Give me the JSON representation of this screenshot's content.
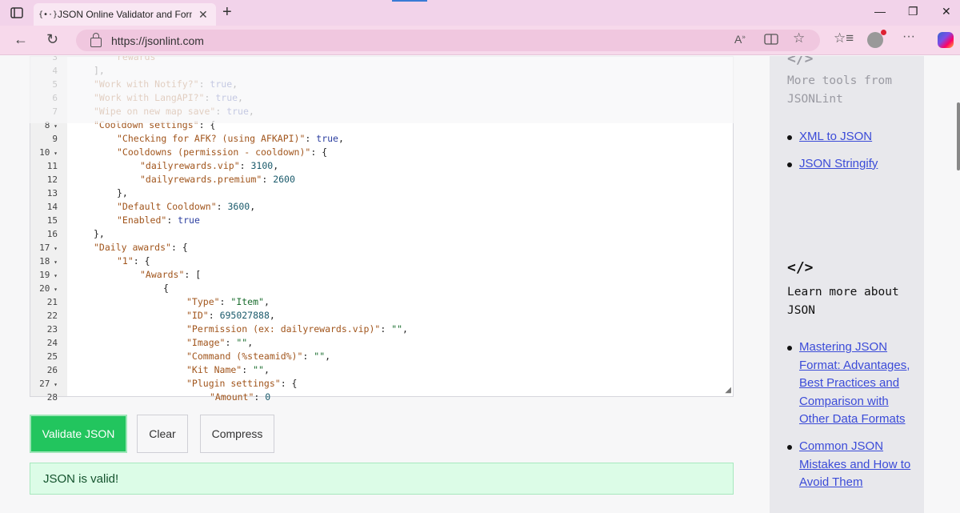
{
  "browser": {
    "tab_title": "JSON Online Validator and Formatter",
    "favicon_text": "{•·}",
    "url": "https://jsonlint.com"
  },
  "editor": {
    "lines": [
      {
        "n": "3",
        "fold": false,
        "indent": 2,
        "tokens": [
          [
            "key",
            "rewards"
          ]
        ]
      },
      {
        "n": "4",
        "fold": false,
        "indent": 1,
        "tokens": [
          [
            "pun",
            "],"
          ]
        ]
      },
      {
        "n": "5",
        "fold": false,
        "indent": 1,
        "tokens": [
          [
            "key",
            "\"Work with Notify?\""
          ],
          [
            "pun",
            ": "
          ],
          [
            "bool",
            "true"
          ],
          [
            "pun",
            ","
          ]
        ]
      },
      {
        "n": "6",
        "fold": false,
        "indent": 1,
        "tokens": [
          [
            "key",
            "\"Work with LangAPI?\""
          ],
          [
            "pun",
            ": "
          ],
          [
            "bool",
            "true"
          ],
          [
            "pun",
            ","
          ]
        ]
      },
      {
        "n": "7",
        "fold": false,
        "indent": 1,
        "tokens": [
          [
            "key",
            "\"Wipe on new map save\""
          ],
          [
            "pun",
            ": "
          ],
          [
            "bool",
            "true"
          ],
          [
            "pun",
            ","
          ]
        ]
      },
      {
        "n": "8",
        "fold": true,
        "indent": 1,
        "tokens": [
          [
            "key",
            "\"Cooldown settings\""
          ],
          [
            "pun",
            ": {"
          ]
        ]
      },
      {
        "n": "9",
        "fold": false,
        "indent": 2,
        "tokens": [
          [
            "key",
            "\"Checking for AFK? (using AFKAPI)\""
          ],
          [
            "pun",
            ": "
          ],
          [
            "bool",
            "true"
          ],
          [
            "pun",
            ","
          ]
        ]
      },
      {
        "n": "10",
        "fold": true,
        "indent": 2,
        "tokens": [
          [
            "key",
            "\"Cooldowns (permission - cooldown)\""
          ],
          [
            "pun",
            ": {"
          ]
        ]
      },
      {
        "n": "11",
        "fold": false,
        "indent": 3,
        "tokens": [
          [
            "key",
            "\"dailyrewards.vip\""
          ],
          [
            "pun",
            ": "
          ],
          [
            "num",
            "3100"
          ],
          [
            "pun",
            ","
          ]
        ]
      },
      {
        "n": "12",
        "fold": false,
        "indent": 3,
        "tokens": [
          [
            "key",
            "\"dailyrewards.premium\""
          ],
          [
            "pun",
            ": "
          ],
          [
            "num",
            "2600"
          ]
        ]
      },
      {
        "n": "13",
        "fold": false,
        "indent": 2,
        "tokens": [
          [
            "pun",
            "},"
          ]
        ]
      },
      {
        "n": "14",
        "fold": false,
        "indent": 2,
        "tokens": [
          [
            "key",
            "\"Default Cooldown\""
          ],
          [
            "pun",
            ": "
          ],
          [
            "num",
            "3600"
          ],
          [
            "pun",
            ","
          ]
        ]
      },
      {
        "n": "15",
        "fold": false,
        "indent": 2,
        "tokens": [
          [
            "key",
            "\"Enabled\""
          ],
          [
            "pun",
            ": "
          ],
          [
            "bool",
            "true"
          ]
        ]
      },
      {
        "n": "16",
        "fold": false,
        "indent": 1,
        "tokens": [
          [
            "pun",
            "},"
          ]
        ]
      },
      {
        "n": "17",
        "fold": true,
        "indent": 1,
        "tokens": [
          [
            "key",
            "\"Daily awards\""
          ],
          [
            "pun",
            ": {"
          ]
        ]
      },
      {
        "n": "18",
        "fold": true,
        "indent": 2,
        "tokens": [
          [
            "key",
            "\"1\""
          ],
          [
            "pun",
            ": {"
          ]
        ]
      },
      {
        "n": "19",
        "fold": true,
        "indent": 3,
        "tokens": [
          [
            "key",
            "\"Awards\""
          ],
          [
            "pun",
            ": ["
          ]
        ]
      },
      {
        "n": "20",
        "fold": true,
        "indent": 4,
        "tokens": [
          [
            "pun",
            "{"
          ]
        ]
      },
      {
        "n": "21",
        "fold": false,
        "indent": 5,
        "tokens": [
          [
            "key",
            "\"Type\""
          ],
          [
            "pun",
            ": "
          ],
          [
            "str",
            "\"Item\""
          ],
          [
            "pun",
            ","
          ]
        ]
      },
      {
        "n": "22",
        "fold": false,
        "indent": 5,
        "tokens": [
          [
            "key",
            "\"ID\""
          ],
          [
            "pun",
            ": "
          ],
          [
            "num",
            "695027888"
          ],
          [
            "pun",
            ","
          ]
        ]
      },
      {
        "n": "23",
        "fold": false,
        "indent": 5,
        "tokens": [
          [
            "key",
            "\"Permission (ex: dailyrewards.vip)\""
          ],
          [
            "pun",
            ": "
          ],
          [
            "str",
            "\"\""
          ],
          [
            "pun",
            ","
          ]
        ]
      },
      {
        "n": "24",
        "fold": false,
        "indent": 5,
        "tokens": [
          [
            "key",
            "\"Image\""
          ],
          [
            "pun",
            ": "
          ],
          [
            "str",
            "\"\""
          ],
          [
            "pun",
            ","
          ]
        ]
      },
      {
        "n": "25",
        "fold": false,
        "indent": 5,
        "tokens": [
          [
            "key",
            "\"Command (%steamid%)\""
          ],
          [
            "pun",
            ": "
          ],
          [
            "str",
            "\"\""
          ],
          [
            "pun",
            ","
          ]
        ]
      },
      {
        "n": "26",
        "fold": false,
        "indent": 5,
        "tokens": [
          [
            "key",
            "\"Kit Name\""
          ],
          [
            "pun",
            ": "
          ],
          [
            "str",
            "\"\""
          ],
          [
            "pun",
            ","
          ]
        ]
      },
      {
        "n": "27",
        "fold": true,
        "indent": 5,
        "tokens": [
          [
            "key",
            "\"Plugin settings\""
          ],
          [
            "pun",
            ": {"
          ]
        ]
      },
      {
        "n": "28",
        "fold": false,
        "indent": 6,
        "tokens": [
          [
            "key",
            "\"Amount\""
          ],
          [
            "pun",
            ": "
          ],
          [
            "num",
            "0"
          ]
        ]
      }
    ]
  },
  "buttons": {
    "validate": "Validate JSON",
    "clear": "Clear",
    "compress": "Compress"
  },
  "result": {
    "message": "JSON is valid!"
  },
  "sidebar": {
    "icon": "</>",
    "more_tools_heading": "More tools from JSONLint",
    "more_tools": [
      "XML to JSON",
      "JSON Stringify"
    ],
    "learn_heading": "Learn more about JSON",
    "learn_links": [
      "Mastering JSON Format: Advantages, Best Practices and Comparison with Other Data Formats",
      "Common JSON Mistakes and How to Avoid Them"
    ]
  }
}
